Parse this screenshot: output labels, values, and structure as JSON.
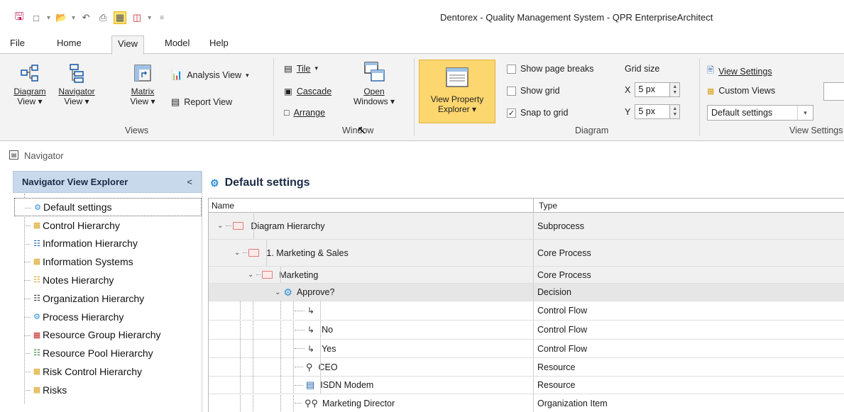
{
  "window": {
    "title": "Dentorex - Quality Management System -  QPR EnterpriseArchitect"
  },
  "quick_access": [
    {
      "icon": "save-icon"
    },
    {
      "icon": "new-icon"
    },
    {
      "icon": "open-icon"
    },
    {
      "icon": "undo-icon"
    },
    {
      "icon": "print-icon"
    },
    {
      "icon": "frame-icon"
    },
    {
      "icon": "layout-icon"
    },
    {
      "icon": "customize-icon"
    }
  ],
  "menu": {
    "tabs": [
      "File",
      "Home",
      "View",
      "Model",
      "Help"
    ],
    "active": "View"
  },
  "ribbon": {
    "views": {
      "label": "Views",
      "diagram_view": {
        "line1": "Diagram",
        "line2": "View",
        "icon": "diagram-view-icon"
      },
      "navigator_view": {
        "line1": "Navigator",
        "line2": "View",
        "icon": "navigator-view-icon"
      },
      "matrix_view": {
        "line1": "Matrix",
        "line2": "View",
        "icon": "matrix-view-icon"
      },
      "analysis_view": "Analysis View",
      "report_view": "Report View"
    },
    "window": {
      "label": "Window",
      "tile": "Tile",
      "cascade": "Cascade",
      "arrange": "Arrange",
      "open_windows": {
        "line1": "Open",
        "line2": "Windows"
      }
    },
    "view_property_explorer": {
      "line1": "View Property",
      "line2": "Explorer"
    },
    "diagram": {
      "label": "Diagram",
      "show_page_breaks": {
        "label": "Show page breaks",
        "checked": false
      },
      "show_grid": {
        "label": "Show grid",
        "checked": false
      },
      "snap_to_grid": {
        "label": "Snap to grid",
        "checked": true
      },
      "grid_size_label": "Grid size",
      "grid_x": {
        "axis": "X",
        "value": "5 px"
      },
      "grid_y": {
        "axis": "Y",
        "value": "5 px"
      }
    },
    "view_settings": {
      "label": "View Settings",
      "view_settings_btn": "View Settings",
      "custom_views": "Custom Views",
      "selected": "Default settings"
    }
  },
  "navigator_header": {
    "title": "Navigator"
  },
  "explorer": {
    "title": "Navigator View Explorer",
    "collapse_glyph": "<",
    "items": [
      {
        "label": "Default settings",
        "icon": "settings-hierarchy-icon",
        "selected": true
      },
      {
        "label": "Control Hierarchy",
        "icon": "control-hierarchy-icon"
      },
      {
        "label": "Information Hierarchy",
        "icon": "information-hierarchy-icon"
      },
      {
        "label": "Information Systems",
        "icon": "information-systems-icon"
      },
      {
        "label": "Notes Hierarchy",
        "icon": "notes-hierarchy-icon"
      },
      {
        "label": "Organization Hierarchy",
        "icon": "organization-hierarchy-icon"
      },
      {
        "label": "Process Hierarchy",
        "icon": "process-hierarchy-icon"
      },
      {
        "label": "Resource Group Hierarchy",
        "icon": "resource-group-hierarchy-icon"
      },
      {
        "label": "Resource Pool Hierarchy",
        "icon": "resource-pool-hierarchy-icon"
      },
      {
        "label": "Risk Control Hierarchy",
        "icon": "risk-control-hierarchy-icon"
      },
      {
        "label": "Risks",
        "icon": "risks-icon"
      }
    ]
  },
  "main": {
    "title": "Default settings",
    "columns": [
      "Name",
      "Type"
    ],
    "rows": [
      {
        "name": "Diagram Hierarchy",
        "type": "Subprocess",
        "icon": "folder-icon"
      },
      {
        "name": "1. Marketing & Sales",
        "type": "Core Process",
        "icon": "folder-icon"
      },
      {
        "name": "Marketing",
        "type": "Core Process",
        "icon": "folder-icon"
      },
      {
        "name": "Approve?",
        "type": "Decision",
        "icon": "decision-gear-icon"
      },
      {
        "name": "",
        "type": "Control Flow",
        "icon": "flow-arrow-icon"
      },
      {
        "name": "No",
        "type": "Control Flow",
        "icon": "flow-arrow-icon"
      },
      {
        "name": "Yes",
        "type": "Control Flow",
        "icon": "flow-arrow-icon"
      },
      {
        "name": "CEO",
        "type": "Resource",
        "icon": "person-icon"
      },
      {
        "name": "ISDN Modem",
        "type": "Resource",
        "icon": "device-icon"
      },
      {
        "name": "Marketing Director",
        "type": "Organization Item",
        "icon": "group-icon"
      }
    ]
  }
}
